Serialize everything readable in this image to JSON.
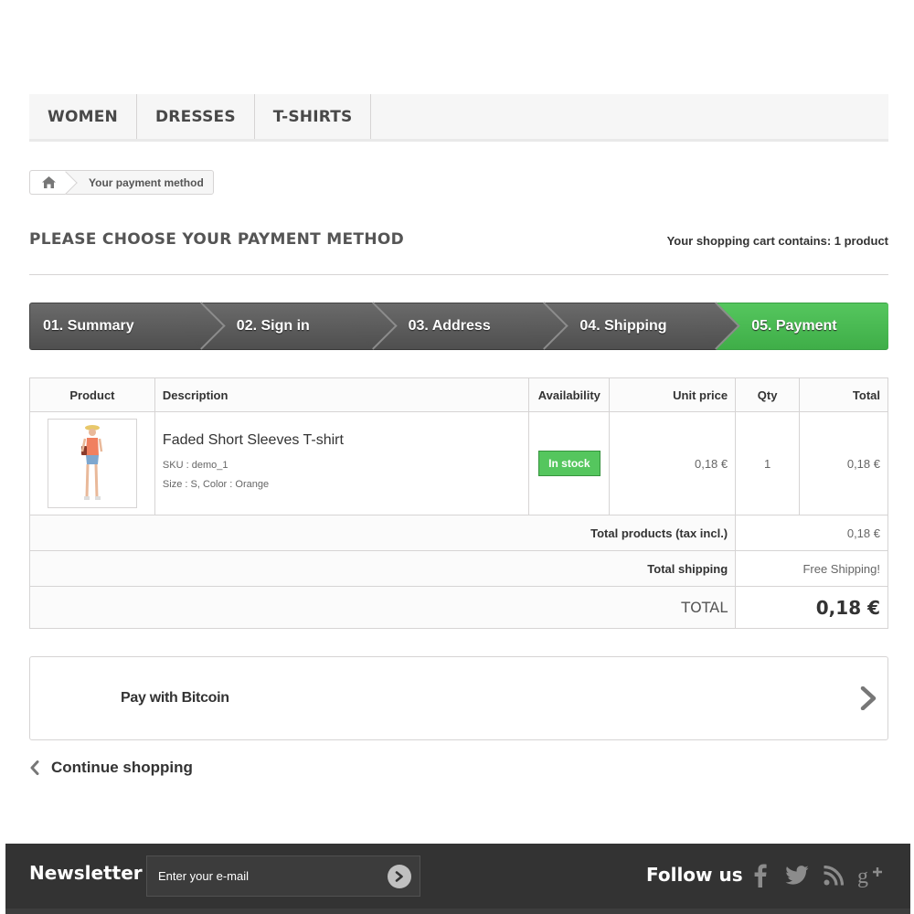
{
  "menu": {
    "items": [
      "WOMEN",
      "DRESSES",
      "T-SHIRTS"
    ]
  },
  "breadcrumb": {
    "current": "Your payment method",
    "home_icon": "home-icon"
  },
  "heading": {
    "title": "PLEASE CHOOSE YOUR PAYMENT METHOD",
    "cart_count": "Your shopping cart contains: 1 product"
  },
  "steps": [
    "01. Summary",
    "02. Sign in",
    "03. Address",
    "04. Shipping",
    "05. Payment"
  ],
  "active_step": 5,
  "table": {
    "headers": {
      "product": "Product",
      "description": "Description",
      "availability": "Availability",
      "unit_price": "Unit price",
      "qty": "Qty",
      "total": "Total"
    },
    "item": {
      "name": "Faded Short Sleeves T-shirt",
      "sku": "SKU : demo_1",
      "attributes": "Size : S, Color : Orange",
      "availability": "In stock",
      "unit_price": "0,18 €",
      "qty": "1",
      "total": "0,18 €"
    },
    "total_products_label": "Total products (tax incl.)",
    "total_products_value": "0,18 €",
    "total_shipping_label": "Total shipping",
    "total_shipping_value": "Free Shipping!",
    "total_label": "TOTAL",
    "total_value": "0,18 €"
  },
  "payment": {
    "option_label": "Pay with Bitcoin"
  },
  "continue_shopping": "Continue shopping",
  "footer": {
    "newsletter_title": "Newsletter",
    "newsletter_placeholder": "Enter your e-mail",
    "follow_title": "Follow us",
    "social_icons": [
      "facebook-icon",
      "twitter-icon",
      "rss-icon",
      "google-plus-icon"
    ]
  },
  "colors": {
    "accent_green": "#55c65e",
    "step_gray": "#5b5b5b",
    "footer_bg": "#333333"
  }
}
